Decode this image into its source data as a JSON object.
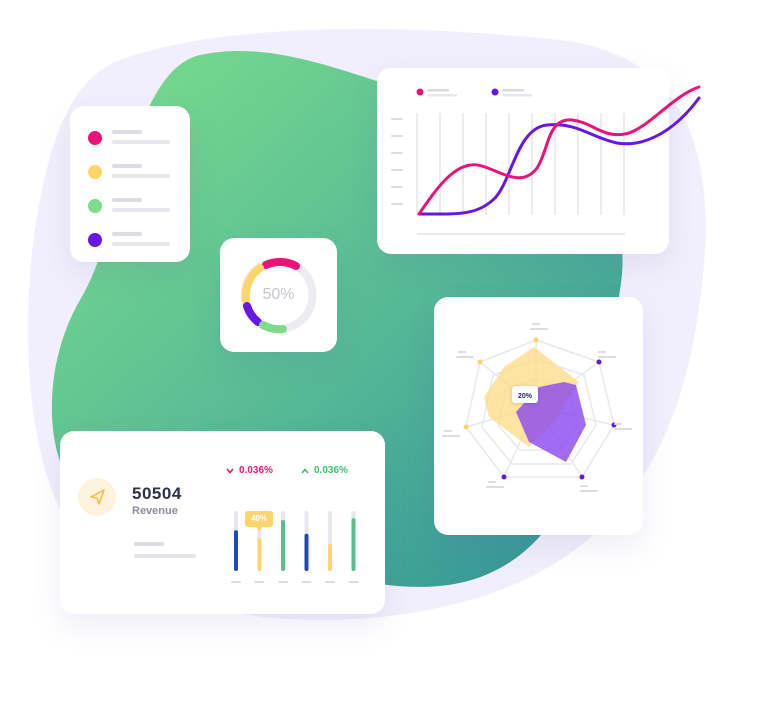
{
  "donut": {
    "percent_label": "50%",
    "value": 0.5
  },
  "legend": {
    "items": [
      {
        "color": "#ec1378"
      },
      {
        "color": "#fed46b"
      },
      {
        "color": "#7fdb8c"
      },
      {
        "color": "#6617e6"
      }
    ]
  },
  "line_chart": {
    "series": [
      {
        "color": "#ec1378"
      },
      {
        "color": "#6617e6"
      }
    ]
  },
  "radar": {
    "tooltip": "20%"
  },
  "revenue": {
    "value": "50504",
    "label": "Revenue",
    "change_down": "0.036%",
    "change_up": "0.036%",
    "bar_tooltip": "40%",
    "bars": [
      {
        "color": "#1f47c4",
        "level": 0.68
      },
      {
        "color": "#fed46b",
        "level": 0.55
      },
      {
        "color": "#55c08a",
        "level": 0.85
      },
      {
        "color": "#1f47c4",
        "level": 0.62
      },
      {
        "color": "#fed46b",
        "level": 0.45
      },
      {
        "color": "#55c08a",
        "level": 0.88
      }
    ]
  },
  "colors": {
    "pink": "#ec1378",
    "purple": "#6617e6",
    "yellow": "#fed46b",
    "green": "#7fdb8c",
    "blob_green": "#6dd487",
    "blob_teal": "#3c9c9a"
  }
}
